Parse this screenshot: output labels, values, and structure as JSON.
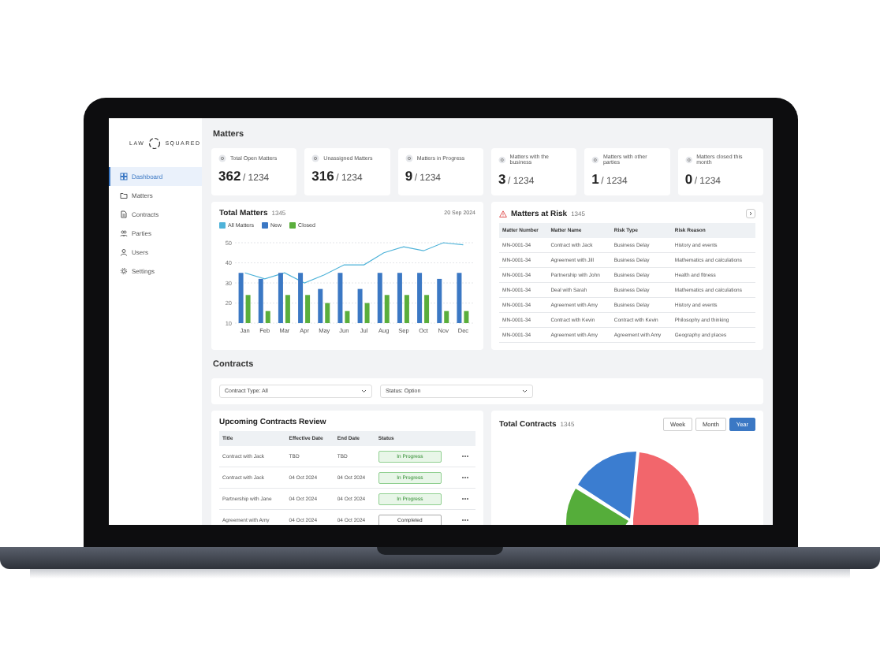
{
  "logo": {
    "left": "LAW",
    "right": "SQUARED"
  },
  "sidebar": {
    "items": [
      {
        "label": "Dashboard",
        "selected": true
      },
      {
        "label": "Matters",
        "selected": false
      },
      {
        "label": "Contracts",
        "selected": false
      },
      {
        "label": "Parties",
        "selected": false
      },
      {
        "label": "Users",
        "selected": false
      },
      {
        "label": "Settings",
        "selected": false
      }
    ]
  },
  "matters": {
    "heading": "Matters",
    "stats": [
      {
        "label": "Total Open Matters",
        "value": "362",
        "total": "/ 1234"
      },
      {
        "label": "Unassigned Matters",
        "value": "316",
        "total": "/ 1234"
      },
      {
        "label": "Matters in Progress",
        "value": "9",
        "total": "/ 1234"
      },
      {
        "label": "Matters with the business",
        "value": "3",
        "total": "/ 1234"
      },
      {
        "label": "Matters with other parties",
        "value": "1",
        "total": "/ 1234"
      },
      {
        "label": "Matters closed this month",
        "value": "0",
        "total": "/ 1234"
      }
    ],
    "total_matters": {
      "title": "Total Matters",
      "count": "1345",
      "date": "20 Sep 2024",
      "chart_data": {
        "type": "bar",
        "categories": [
          "Jan",
          "Feb",
          "Mar",
          "Apr",
          "May",
          "Jun",
          "Jul",
          "Aug",
          "Sep",
          "Oct",
          "Nov",
          "Dec"
        ],
        "ylim": [
          10,
          50
        ],
        "yticks": [
          10,
          20,
          30,
          40,
          50
        ],
        "stacked": false,
        "grid": true,
        "series": [
          {
            "name": "All Matters",
            "color": "#4fb3d9",
            "type": "line",
            "values": [
              35,
              32,
              35,
              30,
              34,
              39,
              39,
              45,
              48,
              46,
              50,
              49
            ]
          },
          {
            "name": "New",
            "color": "#3b78c4",
            "values": [
              35,
              32,
              35,
              35,
              27,
              35,
              27,
              35,
              35,
              35,
              32,
              35
            ]
          },
          {
            "name": "Closed",
            "color": "#5aae3c",
            "values": [
              24,
              16,
              24,
              24,
              20,
              16,
              20,
              24,
              24,
              24,
              16,
              16
            ]
          }
        ]
      }
    },
    "at_risk": {
      "title": "Matters at Risk",
      "count": "1345",
      "columns": [
        "Matter Number",
        "Matter Name",
        "Risk Type",
        "Risk Reason"
      ],
      "rows": [
        [
          "MN-0001-34",
          "Contract with Jack",
          "Business Delay",
          "History and events"
        ],
        [
          "MN-0001-34",
          "Agreement with Jill",
          "Business Delay",
          "Mathematics and calculations"
        ],
        [
          "MN-0001-34",
          "Partnership with John",
          "Business Delay",
          "Health and fitness"
        ],
        [
          "MN-0001-34",
          "Deal with Sarah",
          "Business Delay",
          "Mathematics and calculations"
        ],
        [
          "MN-0001-34",
          "Agreement with Amy",
          "Business Delay",
          "History and events"
        ],
        [
          "MN-0001-34",
          "Contract with Kevin",
          "Contract with Kevin",
          "Philosophy and thinking"
        ],
        [
          "MN-0001-34",
          "Agreement with Amy",
          "Agreement with Amy",
          "Geography and places"
        ]
      ]
    }
  },
  "contracts": {
    "heading": "Contracts",
    "filters": [
      {
        "label": "Contract Type: All"
      },
      {
        "label": "Status: Option"
      }
    ],
    "upcoming": {
      "title": "Upcoming Contracts Review",
      "columns": [
        "Title",
        "Effective Date",
        "End Date",
        "Status"
      ],
      "rows": [
        {
          "cells": [
            "Contract with Jack",
            "TBD",
            "TBD"
          ],
          "status": "In Progress",
          "kind": "progress"
        },
        {
          "cells": [
            "Contract with Jack",
            "04 Oct 2024",
            "04 Oct 2024"
          ],
          "status": "In Progress",
          "kind": "progress"
        },
        {
          "cells": [
            "Partnership with Jane",
            "04 Oct 2024",
            "04 Oct 2024"
          ],
          "status": "In Progress",
          "kind": "progress"
        },
        {
          "cells": [
            "Agreement with Amy",
            "04 Oct 2024",
            "04 Oct 2024"
          ],
          "status": "Completed",
          "kind": "completed"
        }
      ]
    },
    "total": {
      "title": "Total Contracts",
      "count": "1345",
      "periods": [
        {
          "label": "Week",
          "selected": false
        },
        {
          "label": "Month",
          "selected": false
        },
        {
          "label": "Year",
          "selected": true
        }
      ]
    }
  }
}
